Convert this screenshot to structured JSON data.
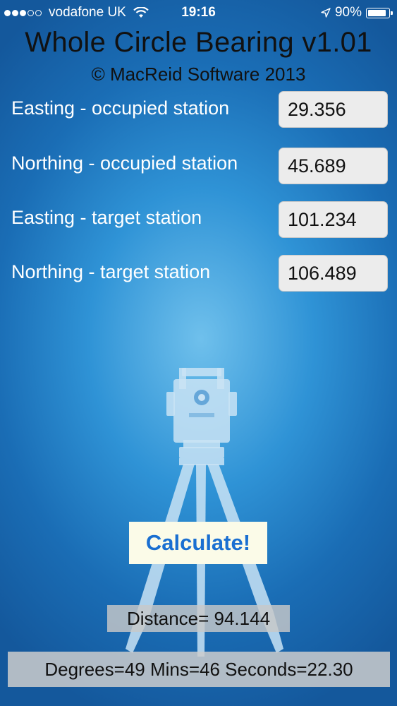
{
  "status_bar": {
    "carrier": "vodafone UK",
    "time": "19:16",
    "battery_percent": "90%",
    "battery_level": 0.9,
    "signal_bars_filled": 3,
    "signal_bars_total": 5
  },
  "header": {
    "title": "Whole Circle Bearing v1.01",
    "subtitle": "© MacReid Software 2013"
  },
  "inputs": [
    {
      "label": "Easting - occupied station",
      "value": "29.356"
    },
    {
      "label": "Northing - occupied station",
      "value": "45.689"
    },
    {
      "label": "Easting - target station",
      "value": "101.234"
    },
    {
      "label": "Northing - target station",
      "value": "106.489"
    }
  ],
  "calculate_label": "Calculate!",
  "results": {
    "distance": "Distance= 94.144",
    "bearing": "Degrees=49 Mins=46 Seconds=22.30"
  },
  "colors": {
    "accent": "#1a6fd1",
    "background_dark": "#14589c",
    "background_light": "#6fc0ec"
  }
}
